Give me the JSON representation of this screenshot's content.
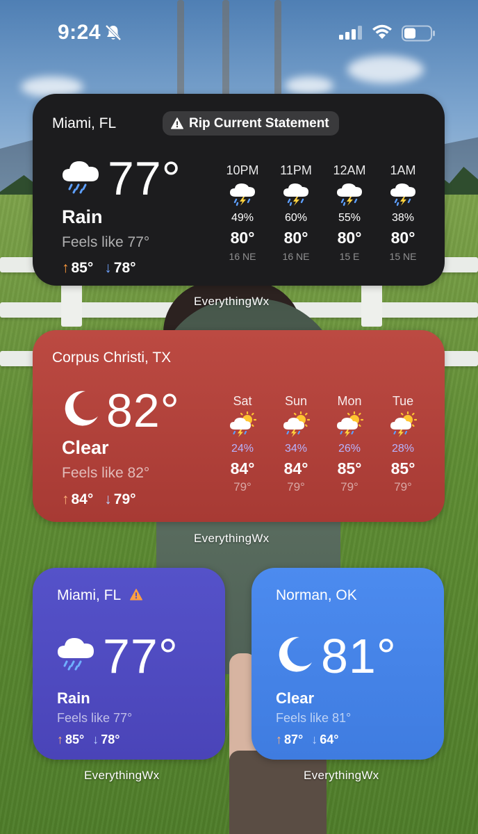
{
  "status_bar": {
    "time": "9:24",
    "icons": [
      "bell-slash-icon",
      "cellular-signal-icon",
      "wifi-icon",
      "battery-icon"
    ]
  },
  "widget_miami_large": {
    "location": "Miami, FL",
    "alert": "Rip Current Statement",
    "alert_icon": "warning-icon",
    "condition_icon": "rain-cloud-icon",
    "temp": "77°",
    "condition": "Rain",
    "feels_like": "Feels like 77°",
    "high": "85°",
    "low": "78°",
    "hourly": [
      {
        "label": "10PM",
        "icon": "thunderstorm-icon",
        "pct": "49%",
        "temp": "80°",
        "wind": "16 NE"
      },
      {
        "label": "11PM",
        "icon": "thunderstorm-icon",
        "pct": "60%",
        "temp": "80°",
        "wind": "16 NE"
      },
      {
        "label": "12AM",
        "icon": "thunderstorm-icon",
        "pct": "55%",
        "temp": "80°",
        "wind": "15 E"
      },
      {
        "label": "1AM",
        "icon": "thunderstorm-icon",
        "pct": "38%",
        "temp": "80°",
        "wind": "15 NE"
      }
    ],
    "source": "EverythingWx",
    "bg_color": "#1c1c1e"
  },
  "widget_corpus": {
    "location": "Corpus Christi, TX",
    "condition_icon": "crescent-moon-icon",
    "temp": "82°",
    "condition": "Clear",
    "feels_like": "Feels like 82°",
    "high": "84°",
    "low": "79°",
    "daily": [
      {
        "label": "Sat",
        "icon": "sun-thunderstorm-icon",
        "pct": "24%",
        "high": "84°",
        "low": "79°"
      },
      {
        "label": "Sun",
        "icon": "sun-thunderstorm-icon",
        "pct": "34%",
        "high": "84°",
        "low": "79°"
      },
      {
        "label": "Mon",
        "icon": "sun-thunderstorm-icon",
        "pct": "26%",
        "high": "85°",
        "low": "79°"
      },
      {
        "label": "Tue",
        "icon": "sun-thunderstorm-icon",
        "pct": "28%",
        "high": "85°",
        "low": "79°"
      }
    ],
    "source": "EverythingWx",
    "bg_color": "#b3433c"
  },
  "widget_miami_small": {
    "location": "Miami, FL",
    "alert_icon": "warning-icon",
    "condition_icon": "rain-cloud-icon",
    "temp": "77°",
    "condition": "Rain",
    "feels_like": "Feels like 77°",
    "high": "85°",
    "low": "78°",
    "source": "EverythingWx",
    "bg_color": "#504cc2"
  },
  "widget_norman": {
    "location": "Norman, OK",
    "condition_icon": "crescent-moon-icon",
    "temp": "81°",
    "condition": "Clear",
    "feels_like": "Feels like 81°",
    "high": "87°",
    "low": "64°",
    "source": "EverythingWx",
    "bg_color": "#4585e8"
  }
}
